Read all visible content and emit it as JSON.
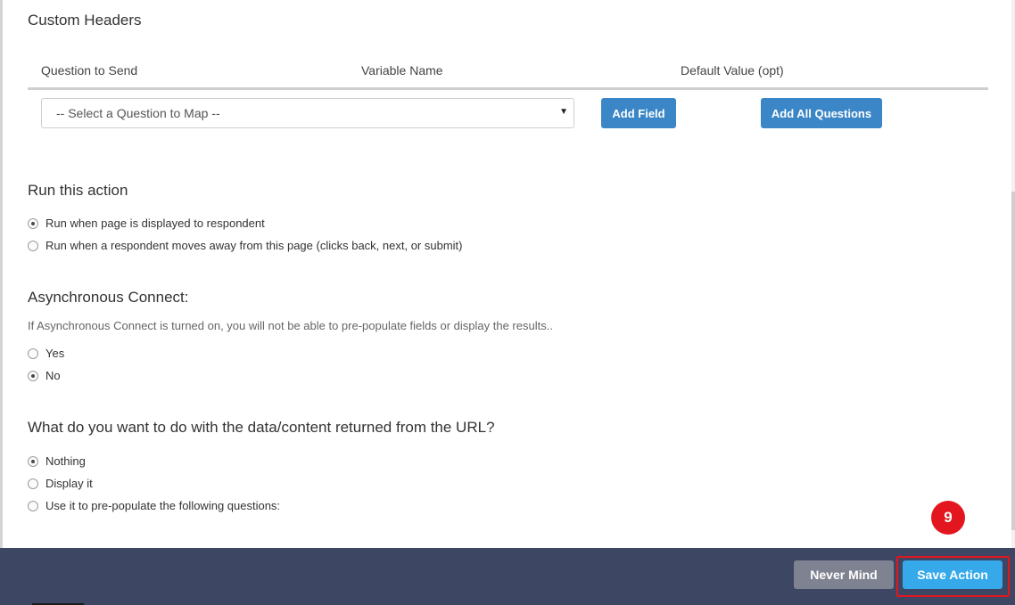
{
  "custom_headers": {
    "title": "Custom Headers",
    "columns": [
      "Question to Send",
      "Variable Name",
      "Default Value (opt)"
    ],
    "select": {
      "value": "-- Select a Question to Map --"
    },
    "add_field_label": "Add Field",
    "add_all_label": "Add All Questions"
  },
  "run_action": {
    "title": "Run this action",
    "options": [
      {
        "label": "Run when page is displayed to respondent",
        "selected": true
      },
      {
        "label": "Run when a respondent moves away from this page (clicks back, next, or submit)",
        "selected": false
      }
    ]
  },
  "async_connect": {
    "title": "Asynchronous Connect:",
    "help": "If Asynchronous Connect is turned on, you will not be able to pre-populate fields or display the results..",
    "options": [
      {
        "label": "Yes",
        "selected": false
      },
      {
        "label": "No",
        "selected": true
      }
    ]
  },
  "returned_data": {
    "title": "What do you want to do with the data/content returned from the URL?",
    "options": [
      {
        "label": "Nothing",
        "selected": true
      },
      {
        "label": "Display it",
        "selected": false
      },
      {
        "label": "Use it to pre-populate the following questions:",
        "selected": false
      }
    ]
  },
  "footer": {
    "never_mind_label": "Never Mind",
    "save_label": "Save Action",
    "step_badge": "9"
  },
  "colors": {
    "primary_button": "#3b86c6",
    "save_button": "#35a9e9",
    "footer_bg": "#3d4663",
    "highlight": "#e3161f"
  }
}
